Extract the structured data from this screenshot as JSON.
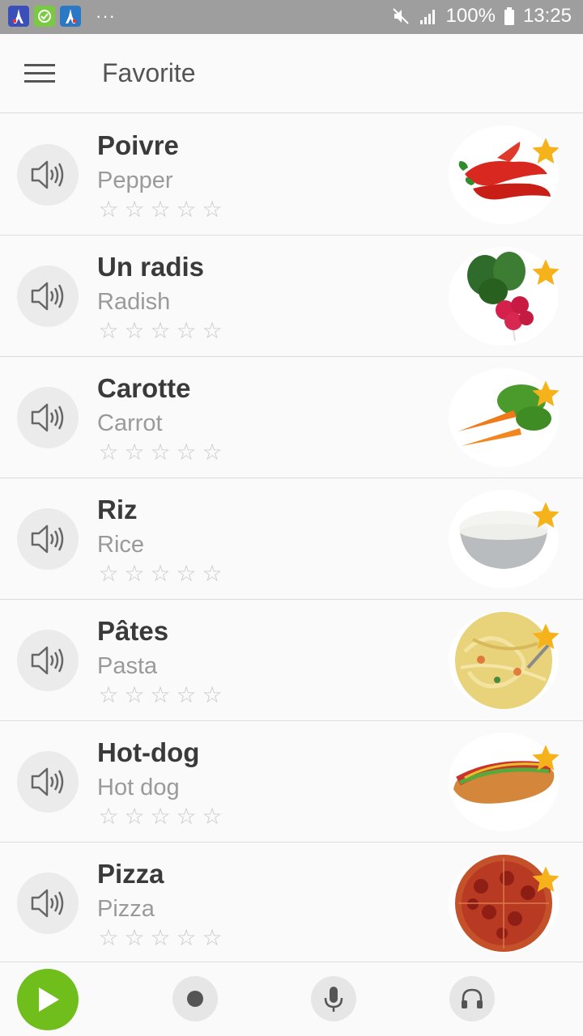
{
  "status_bar": {
    "apps": [
      {
        "name": "french-app-icon",
        "color": "#3b4fb8"
      },
      {
        "name": "vocab-app-icon",
        "color": "#7ac943"
      },
      {
        "name": "learning-app-icon",
        "color": "#2b78c5"
      }
    ],
    "more": "···",
    "battery": "100%",
    "time": "13:25"
  },
  "app_bar": {
    "title": "Favorite"
  },
  "items": [
    {
      "word": "Poivre",
      "translation": "Pepper",
      "image": "pepper-image",
      "favorite": true,
      "rating": 0
    },
    {
      "word": "Un radis",
      "translation": "Radish",
      "image": "radish-image",
      "favorite": true,
      "rating": 0
    },
    {
      "word": "Carotte",
      "translation": "Carrot",
      "image": "carrot-image",
      "favorite": true,
      "rating": 0
    },
    {
      "word": "Riz",
      "translation": "Rice",
      "image": "rice-image",
      "favorite": true,
      "rating": 0
    },
    {
      "word": "Pâtes",
      "translation": "Pasta",
      "image": "pasta-image",
      "favorite": true,
      "rating": 0
    },
    {
      "word": "Hot-dog",
      "translation": "Hot dog",
      "image": "hotdog-image",
      "favorite": true,
      "rating": 0
    },
    {
      "word": "Pizza",
      "translation": "Pizza",
      "image": "pizza-image",
      "favorite": true,
      "rating": 0
    }
  ],
  "bottom_bar": {
    "buttons": [
      "play-icon",
      "record-icon",
      "microphone-icon",
      "headphones-icon"
    ]
  },
  "colors": {
    "accent_green": "#6fbe1c",
    "star_gold": "#f6b21b",
    "status_bar": "#9e9e9e"
  }
}
